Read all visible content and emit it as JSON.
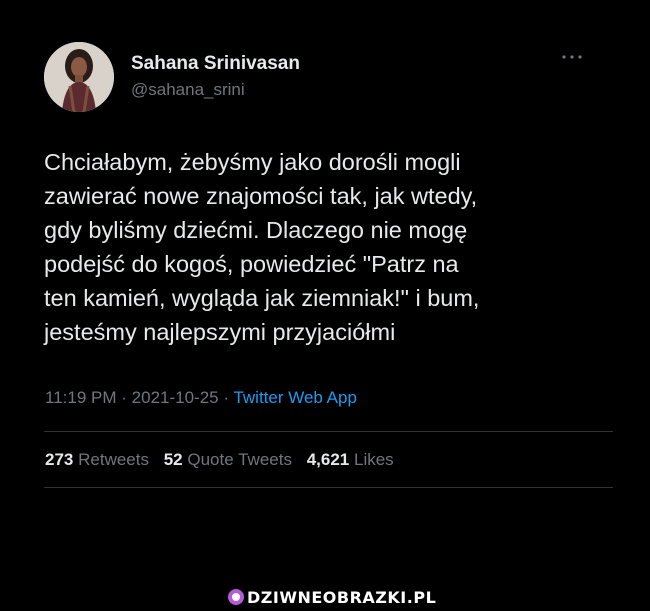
{
  "author": {
    "name": "Sahana Srinivasan",
    "handle": "@sahana_srini",
    "avatar_icon": "profile-photo"
  },
  "more_icon": "ellipsis-icon",
  "tweet": {
    "lines": [
      "Chciałabym, żebyśmy jako dorośli mogli",
      "zawierać nowe znajomości tak, jak wtedy,",
      "gdy byliśmy dziećmi. Dlaczego nie mogę",
      "podejść do kogoś, powiedzieć \"Patrz na",
      "ten kamień, wygląda jak ziemniak!\" i bum,",
      "jesteśmy najlepszymi przyjaciółmi"
    ]
  },
  "meta": {
    "time": "11:19 PM",
    "separator": "·",
    "date": "2021-10-25",
    "source": "Twitter Web App"
  },
  "stats": {
    "retweets_count": "273",
    "retweets_label": "Retweets",
    "quotes_count": "52",
    "quotes_label": "Quote Tweets",
    "likes_count": "4,621",
    "likes_label": "Likes"
  },
  "watermark": {
    "text": "DZIWNEOBRAZKI.PL"
  },
  "colors": {
    "background": "#000000",
    "text": "#e7e9ea",
    "secondary": "#71767b",
    "link": "#1d9bf0",
    "divider": "#2f3336"
  }
}
